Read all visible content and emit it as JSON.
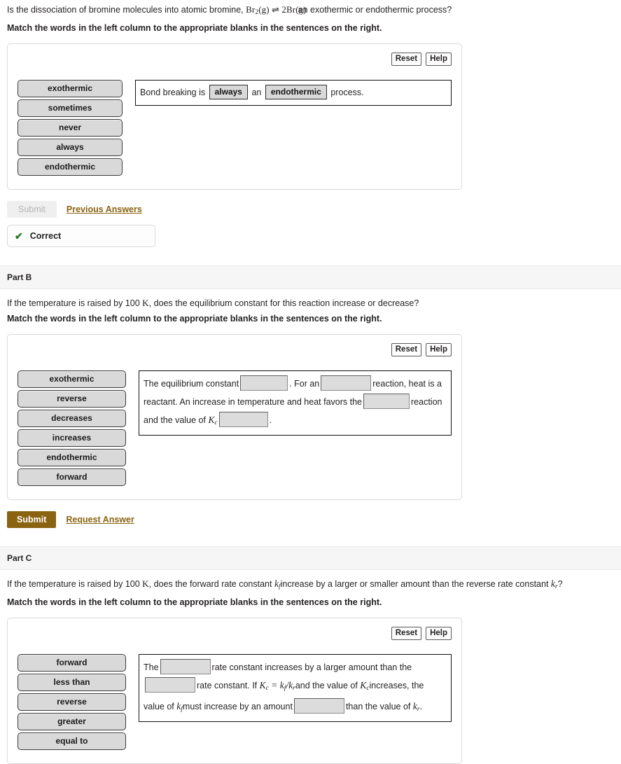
{
  "parts": [
    {
      "id": "A",
      "header_label": "",
      "question_pre": "Is the dissociation of bromine molecules into atomic bromine, ",
      "equation": "Br2(g) ⇌ 2Br(g)",
      "equation_parts": {
        "lhs": "Br",
        "lhs_sub": "2",
        "lhs_state": "(g)",
        "arrow": "⇌",
        "rhs_coef": "2",
        "rhs": "Br",
        "rhs_state": "(g)"
      },
      "question_post": "an exothermic or endothermic process?",
      "instruction": "Match the words in the left column to the appropriate blanks in the sentences on the right.",
      "tools": {
        "reset": "Reset",
        "help": "Help"
      },
      "word_bank": [
        "exothermic",
        "sometimes",
        "never",
        "always",
        "endothermic"
      ],
      "sentence_tokens": [
        {
          "type": "text",
          "value": "Bond breaking is"
        },
        {
          "type": "filled",
          "value": "always"
        },
        {
          "type": "text",
          "value": "an"
        },
        {
          "type": "filled",
          "value": "endothermic"
        },
        {
          "type": "text",
          "value": "process."
        }
      ],
      "submit_label": "Submit",
      "submit_state": "disabled",
      "secondary_link": "Previous Answers",
      "feedback": {
        "icon": "check-icon",
        "label": "Correct"
      }
    },
    {
      "id": "B",
      "header_label": "Part B",
      "question_pre": "If the temperature is raised by 100 ",
      "question_unit": "K",
      "question_post": ", does the equilibrium constant for this reaction increase or decrease?",
      "instruction": "Match the words in the left column to the appropriate blanks in the sentences on the right.",
      "tools": {
        "reset": "Reset",
        "help": "Help"
      },
      "word_bank": [
        "exothermic",
        "reverse",
        "decreases",
        "increases",
        "endothermic",
        "forward"
      ],
      "sentence_tokens": [
        {
          "type": "text",
          "value": "The equilibrium constant"
        },
        {
          "type": "blank",
          "value": ""
        },
        {
          "type": "text",
          "value": ". For an"
        },
        {
          "type": "blank",
          "value": ""
        },
        {
          "type": "text",
          "value": "reaction, heat is a reactant. An increase in temperature and heat favors the"
        },
        {
          "type": "blank",
          "value": ""
        },
        {
          "type": "text",
          "value": "reaction and the value of"
        },
        {
          "type": "math",
          "value": "Kc"
        },
        {
          "type": "blank",
          "value": ""
        },
        {
          "type": "text",
          "value": "."
        }
      ],
      "submit_label": "Submit",
      "submit_state": "active",
      "secondary_link": "Request Answer"
    },
    {
      "id": "C",
      "header_label": "Part C",
      "question_pre": "If the temperature is raised by 100 ",
      "question_unit": "K",
      "question_mid": ", does the forward rate constant ",
      "question_var1": "kf",
      "question_mid2": "increase by a larger or smaller amount than the reverse rate constant ",
      "question_var2": "kr",
      "question_post": "?",
      "instruction": "Match the words in the left column to the appropriate blanks in the sentences on the right.",
      "tools": {
        "reset": "Reset",
        "help": "Help"
      },
      "word_bank": [
        "forward",
        "less than",
        "reverse",
        "greater",
        "equal to"
      ],
      "sentence_tokens": [
        {
          "type": "text",
          "value": "The"
        },
        {
          "type": "blank",
          "value": ""
        },
        {
          "type": "text",
          "value": "rate constant increases by a larger amount than the"
        },
        {
          "type": "blank",
          "value": ""
        },
        {
          "type": "text",
          "value": "rate constant. If"
        },
        {
          "type": "math",
          "value": "Kc = kf/kr"
        },
        {
          "type": "text",
          "value": "and the value of"
        },
        {
          "type": "math",
          "value": "Kc"
        },
        {
          "type": "text",
          "value": "increases, the value of"
        },
        {
          "type": "math",
          "value": "kf"
        },
        {
          "type": "text",
          "value": "must increase by an amount"
        },
        {
          "type": "blank",
          "value": ""
        },
        {
          "type": "text",
          "value": "than the value of"
        },
        {
          "type": "math",
          "value": "kr"
        },
        {
          "type": "text",
          "value": "."
        }
      ]
    }
  ],
  "colors": {
    "link": "#8a6312",
    "submit_active_bg": "#8a6312",
    "chip_bg": "#d9d9d9",
    "correct_green": "#1d7a1d",
    "header_band": "#f6f6f6"
  }
}
